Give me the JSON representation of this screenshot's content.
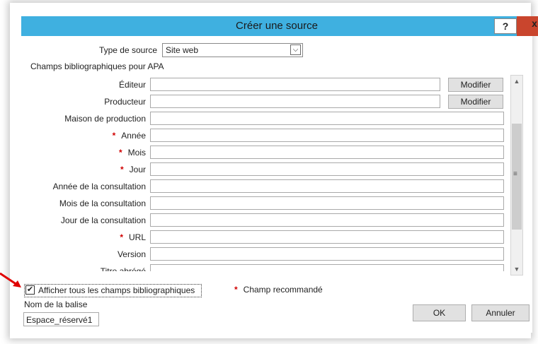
{
  "window": {
    "title": "Créer une source",
    "help_label": "?",
    "close_label": "x"
  },
  "source_type": {
    "label": "Type de source",
    "value": "Site web"
  },
  "section_title": "Champs bibliographiques pour APA",
  "fields": [
    {
      "label": "Éditeur",
      "required": false,
      "button": "Modifier",
      "value": ""
    },
    {
      "label": "Producteur",
      "required": false,
      "button": "Modifier",
      "value": ""
    },
    {
      "label": "Maison de production",
      "required": false,
      "value": ""
    },
    {
      "label": "Année",
      "required": true,
      "value": ""
    },
    {
      "label": "Mois",
      "required": true,
      "value": ""
    },
    {
      "label": "Jour",
      "required": true,
      "value": ""
    },
    {
      "label": "Année de la consultation",
      "required": false,
      "value": ""
    },
    {
      "label": "Mois de la consultation",
      "required": false,
      "value": ""
    },
    {
      "label": "Jour de la consultation",
      "required": false,
      "value": ""
    },
    {
      "label": "URL",
      "required": true,
      "value": ""
    },
    {
      "label": "Version",
      "required": false,
      "value": ""
    },
    {
      "label": "Titre abrégé",
      "required": false,
      "value": ""
    }
  ],
  "required_symbol": "*",
  "show_all": {
    "label": "Afficher tous les champs bibliographiques",
    "checked": true,
    "check_glyph": "✔"
  },
  "legend_text": "Champ recommandé",
  "tag": {
    "label": "Nom de la balise",
    "value": "Espace_réservé1"
  },
  "buttons": {
    "ok": "OK",
    "cancel": "Annuler"
  },
  "scrollbar": {
    "up": "▲",
    "down": "▼",
    "grip": "≡"
  },
  "colors": {
    "titlebar": "#3fb0e0",
    "close": "#c9452d",
    "required_star": "#d00000",
    "annotation_arrow": "#e00000"
  }
}
